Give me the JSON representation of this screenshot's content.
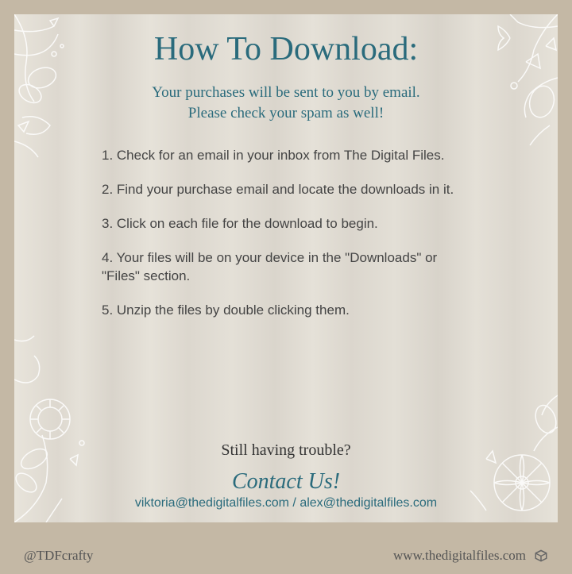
{
  "title": "How To Download:",
  "subtitle_line1": "Your purchases will be sent to you by email.",
  "subtitle_line2": "Please check your spam as well!",
  "steps": [
    "1. Check for an email in your inbox from The Digital Files.",
    "2. Find your purchase email and locate the downloads in it.",
    "3. Click on each file for the download to begin.",
    "4. Your files will be on your device in the \"Downloads\" or \"Files\" section.",
    "5. Unzip the files by double clicking them."
  ],
  "trouble_text": "Still having trouble?",
  "contact_us": "Contact Us!",
  "emails": "viktoria@thedigitalfiles.com / alex@thedigitalfiles.com",
  "footer": {
    "handle": "@TDFcrafty",
    "website": "www.thedigitalfiles.com"
  }
}
